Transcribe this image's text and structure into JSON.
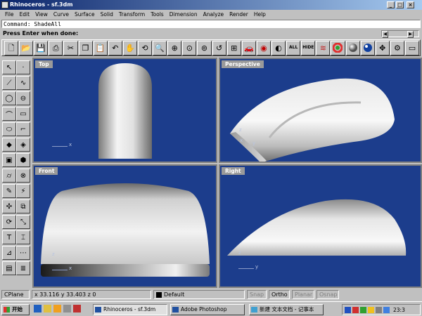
{
  "window": {
    "title": "Rhinoceros - sf.3dm",
    "minimize_glyph": "_",
    "maximize_glyph": "□",
    "close_glyph": "×"
  },
  "menu": [
    "File",
    "Edit",
    "View",
    "Curve",
    "Surface",
    "Solid",
    "Transform",
    "Tools",
    "Dimension",
    "Analyze",
    "Render",
    "Help"
  ],
  "command": {
    "history": "Command: ShadeAll",
    "prompt": "Press Enter when done:"
  },
  "toolbar_icons": [
    "new-icon",
    "open-icon",
    "save-icon",
    "print-icon",
    "cut-icon",
    "copy-icon",
    "paste-icon",
    "undo-icon",
    "pan-icon",
    "rotate-view-icon",
    "zoom-icon",
    "zoom-window-icon",
    "zoom-extents-icon",
    "zoom-selected-icon",
    "undo-view-icon",
    "four-viewports-icon",
    "car-render-icon",
    "render-icon",
    "layer-icon",
    "all-icon",
    "hide-icon",
    "color-wheel-icon",
    "sphere-icon",
    "globe-icon",
    "settings-icon",
    "options-icon",
    "properties-icon"
  ],
  "toolbar_text": {
    "all": "ALL",
    "hide": "HIDE"
  },
  "viewports": {
    "top": {
      "label": "Top",
      "axis_x": "x",
      "axis_y": "y"
    },
    "perspective": {
      "label": "Perspective",
      "axis_x": "x",
      "axis_y": "y",
      "axis_z": "z"
    },
    "front": {
      "label": "Front",
      "axis_x": "x",
      "axis_z": "z"
    },
    "right": {
      "label": "Right",
      "axis_y": "y",
      "axis_z": "z"
    }
  },
  "status": {
    "cplane": "CPlane",
    "coords": "x 33.116  y 33.403  z 0",
    "layer": "Default",
    "snap": "Snap",
    "ortho": "Ortho",
    "planar": "Planar",
    "osnap": "Osnap"
  },
  "taskbar": {
    "start": "开始",
    "tasks": [
      "Rhinoceros - sf.3dm",
      "Adobe Photoshop",
      "新建 文本文档 - 记事本"
    ],
    "clock": "23:3"
  },
  "colors": {
    "viewport_bg": "#1c3d8c",
    "title_active": "#0a246a",
    "chrome": "#c0c0c0"
  }
}
